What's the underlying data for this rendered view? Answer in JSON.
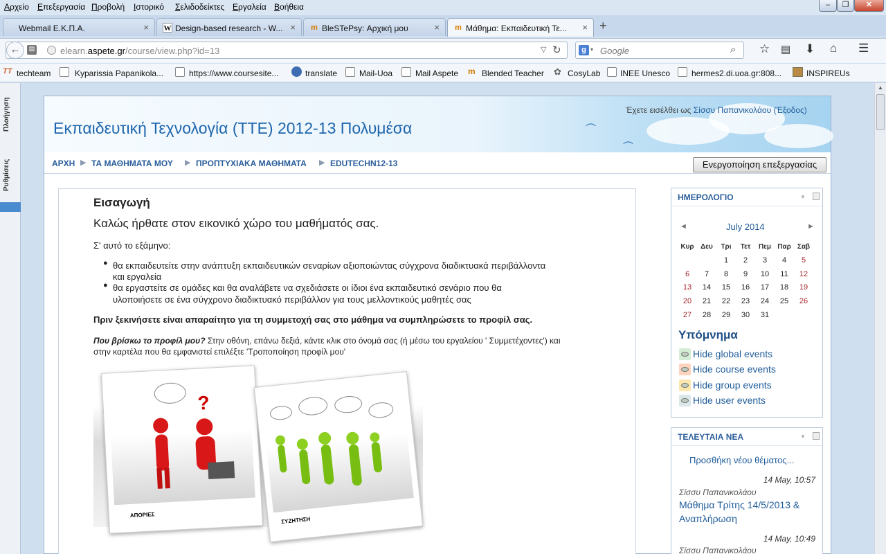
{
  "menu": [
    "Αρχείο",
    "Επεξεργασία",
    "Προβολή",
    "Ιστορικό",
    "Σελιδοδείκτες",
    "Εργαλεία",
    "Βοήθεια"
  ],
  "tabs": [
    {
      "label": "Webmail Ε.Κ.Π.Α."
    },
    {
      "label": "Design-based research - W..."
    },
    {
      "label": "BleSTePsy: Αρχική μου"
    },
    {
      "label": "Μάθημα: Εκπαιδευτική Τε..."
    }
  ],
  "url": {
    "domain_pre": "elearn.",
    "domain": "aspete.gr",
    "path": "/course/view.php?id=13"
  },
  "search": {
    "placeholder": "Google"
  },
  "bookmarks": [
    "techteam",
    "Kyparissia Papanikola...",
    "https://www.coursesite...",
    "translate",
    "Mail-Uoa",
    "Mail Aspete",
    "Blended Teacher",
    "CosyLab",
    "INEE Unesco",
    "hermes2.di.uoa.gr:808...",
    "INSPIREUs"
  ],
  "rail": {
    "navigation": "Πλοήγηση",
    "settings": "Ρυθμίσεις"
  },
  "header": {
    "course_title": "Εκπαιδευτική Τεχνολογία (ΤΤΕ) 2012-13 Πολυμέσα",
    "login_prefix": "Έχετε εισέλθει ως ",
    "user": "Σίσσυ Παπανικολάου",
    "logout": "(Έξοδος)"
  },
  "breadcrumb": [
    "ΑΡΧΗ",
    "ΤΑ ΜΑΘΗΜΑΤΑ ΜΟΥ",
    "ΠΡΟΠΤΥΧΙΑΚΑ ΜΑΘΗΜΑΤΑ",
    "EDUTECHN12-13"
  ],
  "edit_button": "Ενεργοποίηση επεξεργασίας",
  "intro": {
    "heading": "Εισαγωγή",
    "welcome": "Καλώς ήρθατε στον εικονικό χώρο του μαθήματός σας.",
    "semester": "Σ' αυτό το εξάμηνο:",
    "bullets": [
      [
        "θα εκπαιδευτείτε στην ανάπτυξη εκπαιδευτικών σεναρίων αξιοποιώντας σύγχρονα διαδικτυακά περιβάλλοντα",
        "και εργαλεία"
      ],
      [
        "θα εργαστείτε σε ομάδες και θα αναλάβετε να σχεδιάσετε οι ίδιοι ένα εκπαιδευτικό σενάριο που θα",
        "υλοποιήσετε σε ένα σύγχρονο διαδικτυακό περιβάλλον για τους μελλοντικούς μαθητές σας"
      ]
    ],
    "notice": "Πριν ξεκινήσετε είναι απαραίτητο για τη συμμετοχή σας στο μάθημα να συμπληρώσετε το προφίλ σας.",
    "profile_q": "Που βρίσκω το προφίλ μου?",
    "profile_a1": " Στην οθόνη, επάνω δεξιά, κάντε κλικ στο όνομά σας (ή μέσω του εργαλείου ' Συμμετέχοντες') και",
    "profile_a2": "στην καρτέλα που θα εμφανιστεί επιλέξτε 'Τροποποίηση προφίλ μου'",
    "photo1": "ΑΠΟΡΙΕΣ",
    "photo2": "ΣΥΖΗΤΗΣΗ"
  },
  "calendar": {
    "title": "ΗΜΕΡΟΛΟΓΙΟ",
    "month": "July 2014",
    "days": [
      "Κυρ",
      "Δευ",
      "Τρι",
      "Τετ",
      "Πεμ",
      "Παρ",
      "Σαβ"
    ],
    "weeks": [
      [
        "",
        "",
        "1",
        "2",
        "3",
        "4",
        "5"
      ],
      [
        "6",
        "7",
        "8",
        "9",
        "10",
        "11",
        "12"
      ],
      [
        "13",
        "14",
        "15",
        "16",
        "17",
        "18",
        "19"
      ],
      [
        "20",
        "21",
        "22",
        "23",
        "24",
        "25",
        "26"
      ],
      [
        "27",
        "28",
        "29",
        "30",
        "31",
        "",
        ""
      ]
    ],
    "legend_title": "Υπόμνημα",
    "legend": [
      {
        "label": "Hide global events",
        "color": "#d5ecd5"
      },
      {
        "label": "Hide course events",
        "color": "#ffd3bd"
      },
      {
        "label": "Hide group events",
        "color": "#fee7ae"
      },
      {
        "label": "Hide user events",
        "color": "#dce7ec"
      }
    ]
  },
  "news": {
    "title": "ΤΕΛΕΥΤΑΙΑ ΝΕΑ",
    "add": "Προσθήκη νέου θέματος...",
    "items": [
      {
        "date": "14 May, 10:57",
        "author": "Σίσσυ Παπανικολάου",
        "title1": "Μάθημα Τρίτης 14/5/2013 &",
        "title2": "Αναπλήρωση"
      },
      {
        "date": "14 May, 10:49",
        "author": "Σίσσυ Παπανικολάου"
      }
    ]
  }
}
